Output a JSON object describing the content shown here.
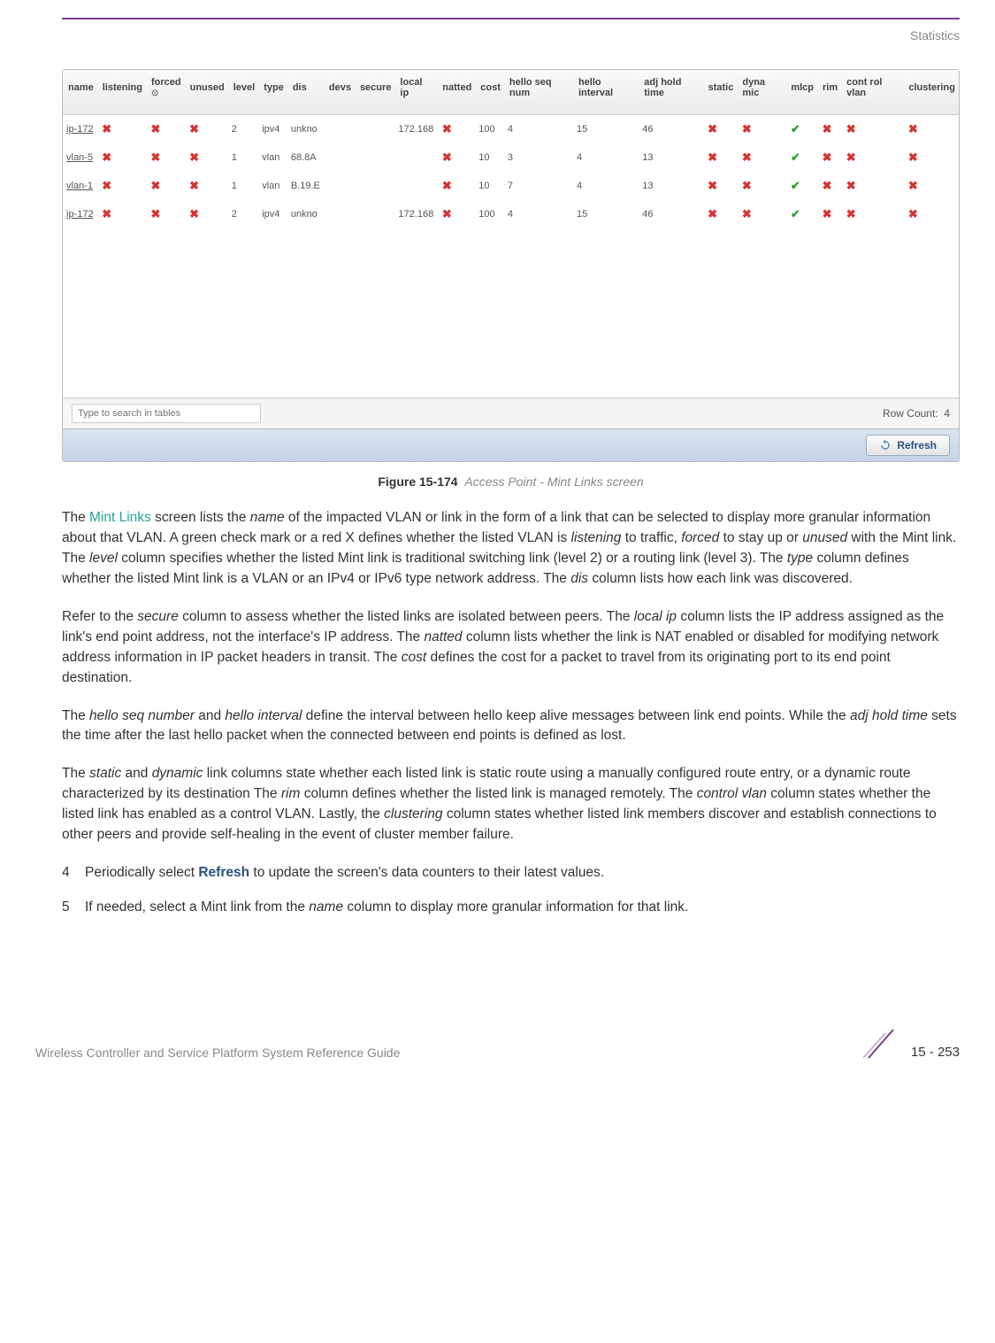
{
  "header": {
    "section": "Statistics"
  },
  "screenshot": {
    "columns": [
      "name",
      "listening",
      "forced",
      "unused",
      "level",
      "type",
      "dis",
      "devs",
      "secure",
      "local ip",
      "natted",
      "cost",
      "hello seq num",
      "hello interval",
      "adj hold time",
      "static",
      "dyna mic",
      "mlcp",
      "rim",
      "cont rol vlan",
      "clustering"
    ],
    "forced_sub": "⊙",
    "rows": [
      {
        "name": "ip-172",
        "listening": "x",
        "forced": "x",
        "unused": "x",
        "level": "2",
        "type": "ipv4",
        "dis": "unkno",
        "devs": "",
        "secure": "",
        "local_ip": "172.168",
        "natted": "x",
        "cost": "100",
        "hello_seq_num": "4",
        "hello_interval": "15",
        "adj_hold_time": "46",
        "static": "x",
        "dynamic": "x",
        "mlcp": "check",
        "rim": "x",
        "control_vlan": "x",
        "clustering": "x"
      },
      {
        "name": "vlan-5",
        "listening": "x",
        "forced": "x",
        "unused": "x",
        "level": "1",
        "type": "vlan",
        "dis": "68.8A",
        "devs": "",
        "secure": "",
        "local_ip": "",
        "natted": "x",
        "cost": "10",
        "hello_seq_num": "3",
        "hello_interval": "4",
        "adj_hold_time": "13",
        "static": "x",
        "dynamic": "x",
        "mlcp": "check",
        "rim": "x",
        "control_vlan": "x",
        "clustering": "x"
      },
      {
        "name": "vlan-1",
        "listening": "x",
        "forced": "x",
        "unused": "x",
        "level": "1",
        "type": "vlan",
        "dis": "B.19.E",
        "devs": "",
        "secure": "",
        "local_ip": "",
        "natted": "x",
        "cost": "10",
        "hello_seq_num": "7",
        "hello_interval": "4",
        "adj_hold_time": "13",
        "static": "x",
        "dynamic": "x",
        "mlcp": "check",
        "rim": "x",
        "control_vlan": "x",
        "clustering": "x"
      },
      {
        "name": "ip-172",
        "listening": "x",
        "forced": "x",
        "unused": "x",
        "level": "2",
        "type": "ipv4",
        "dis": "unkno",
        "devs": "",
        "secure": "",
        "local_ip": "172.168",
        "natted": "x",
        "cost": "100",
        "hello_seq_num": "4",
        "hello_interval": "15",
        "adj_hold_time": "46",
        "static": "x",
        "dynamic": "x",
        "mlcp": "check",
        "rim": "x",
        "control_vlan": "x",
        "clustering": "x"
      }
    ],
    "search_placeholder": "Type to search in tables",
    "row_count_label": "Row Count:",
    "row_count_value": "4",
    "refresh_label": "Refresh"
  },
  "figure": {
    "label": "Figure 15-174",
    "desc": "Access Point - Mint Links screen"
  },
  "paragraphs": {
    "p1_a": "The ",
    "p1_highlight": "Mint Links",
    "p1_b": " screen lists the ",
    "p1_i1": "name",
    "p1_c": " of the impacted VLAN or link in the form of a link that can be selected to display more granular information about that VLAN. A green check mark or a red X defines whether the listed VLAN is ",
    "p1_i2": "listening",
    "p1_d": " to traffic, ",
    "p1_i3": "forced",
    "p1_e": " to stay up or ",
    "p1_i4": "unused",
    "p1_f": " with the Mint link. The ",
    "p1_i5": "level",
    "p1_g": " column specifies whether the listed Mint link is traditional switching link (level 2) or a routing link (level 3). The ",
    "p1_i6": "type",
    "p1_h": " column defines whether the listed Mint link is a VLAN or an IPv4 or IPv6 type network address. The ",
    "p1_i7": "dis",
    "p1_j": " column lists how each link was discovered.",
    "p2_a": "Refer to the ",
    "p2_i1": "secure",
    "p2_b": " column to assess whether the listed links are isolated between peers. The ",
    "p2_i2": "local ip",
    "p2_c": " column lists the IP address assigned as the link's end point address, not the interface's IP address. The ",
    "p2_i3": "natted",
    "p2_d": " column lists whether the link is NAT enabled or disabled for modifying network address information in IP packet headers in transit. The ",
    "p2_i4": "cost",
    "p2_e": " defines the cost for a packet to travel from its originating port to its end point destination.",
    "p3_a": "The ",
    "p3_i1": "hello seq number",
    "p3_b": " and ",
    "p3_i2": "hello interval",
    "p3_c": " define the interval between hello keep alive messages between link end points. While the ",
    "p3_i3": "adj hold time",
    "p3_d": " sets the time after the last hello packet when the connected between end points is defined as lost.",
    "p4_a": "The ",
    "p4_i1": "static",
    "p4_b": " and ",
    "p4_i2": "dynamic",
    "p4_c": " link columns state whether each listed link is static route using a manually configured route entry, or a dynamic route characterized by its destination The ",
    "p4_i3": "rim",
    "p4_d": " column defines whether the listed link is managed remotely. The ",
    "p4_i4": "control vlan",
    "p4_e": " column states whether the listed link has enabled as a control VLAN. Lastly, the ",
    "p4_i5": "clustering",
    "p4_f": " column states whether listed link members discover and establish connections to other peers and provide self-healing in the event of cluster member failure."
  },
  "steps": {
    "s4_num": "4",
    "s4_a": "Periodically select ",
    "s4_strong": "Refresh",
    "s4_b": " to update the screen's data counters to their latest values.",
    "s5_num": "5",
    "s5_a": "If needed, select a Mint link from the ",
    "s5_i": "name",
    "s5_b": " column to display more granular information for that link."
  },
  "footer": {
    "left": "Wireless Controller and Service Platform System Reference Guide",
    "right": "15 - 253"
  }
}
